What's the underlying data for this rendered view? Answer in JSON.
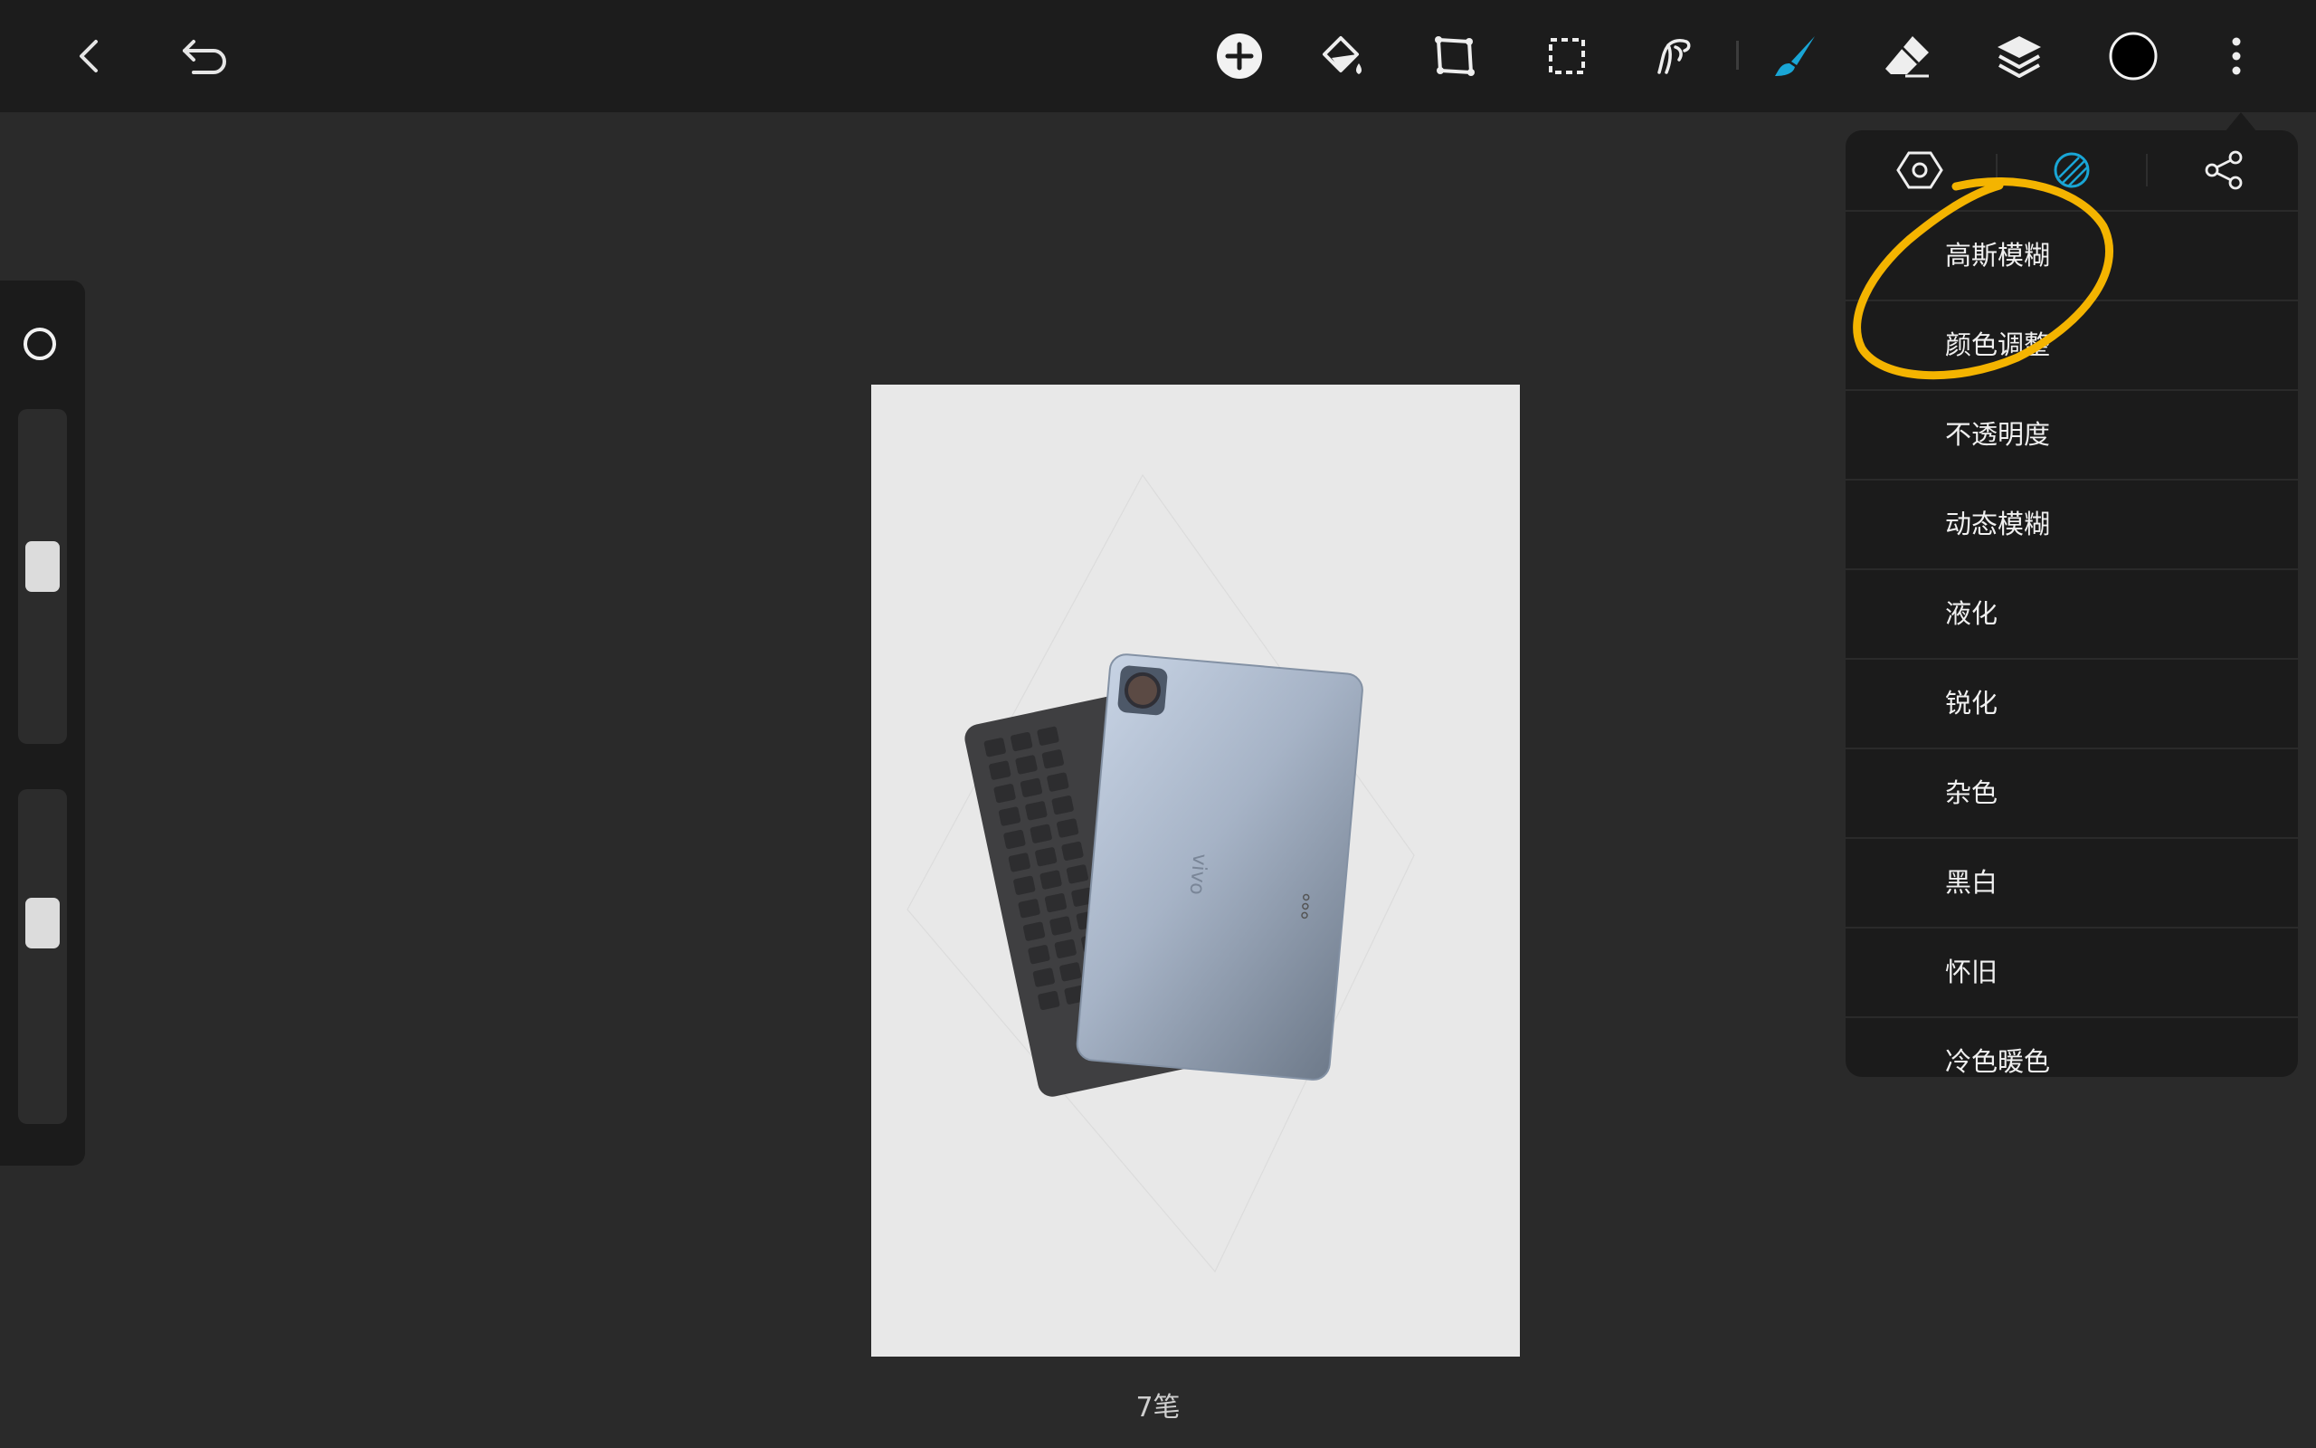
{
  "toolbar": {
    "accent_color": "#19a6d6",
    "current_color": "#000000",
    "icons": [
      "back-icon",
      "undo-icon",
      "add-icon",
      "fill-bucket-icon",
      "transform-icon",
      "selection-icon",
      "smudge-icon",
      "brush-icon",
      "eraser-icon",
      "layers-icon",
      "color-swatch",
      "more-icon"
    ]
  },
  "canvas": {
    "stroke_count": "7笔",
    "background": "#e8e8e8",
    "brand_text": "vivo"
  },
  "side_panel": {
    "brush_size_level": 0.46,
    "opacity_level": 0.42
  },
  "popup": {
    "tabs": [
      "settings-icon",
      "adjustments-icon",
      "share-icon"
    ],
    "active_tab": 1,
    "items": [
      {
        "label": "高斯模糊"
      },
      {
        "label": "颜色调整"
      },
      {
        "label": "不透明度"
      },
      {
        "label": "动态模糊"
      },
      {
        "label": "液化"
      },
      {
        "label": "锐化"
      },
      {
        "label": "杂色"
      },
      {
        "label": "黑白"
      },
      {
        "label": "怀旧"
      },
      {
        "label": "冷色暖色"
      }
    ]
  },
  "annotation": {
    "color": "#f4b400"
  }
}
